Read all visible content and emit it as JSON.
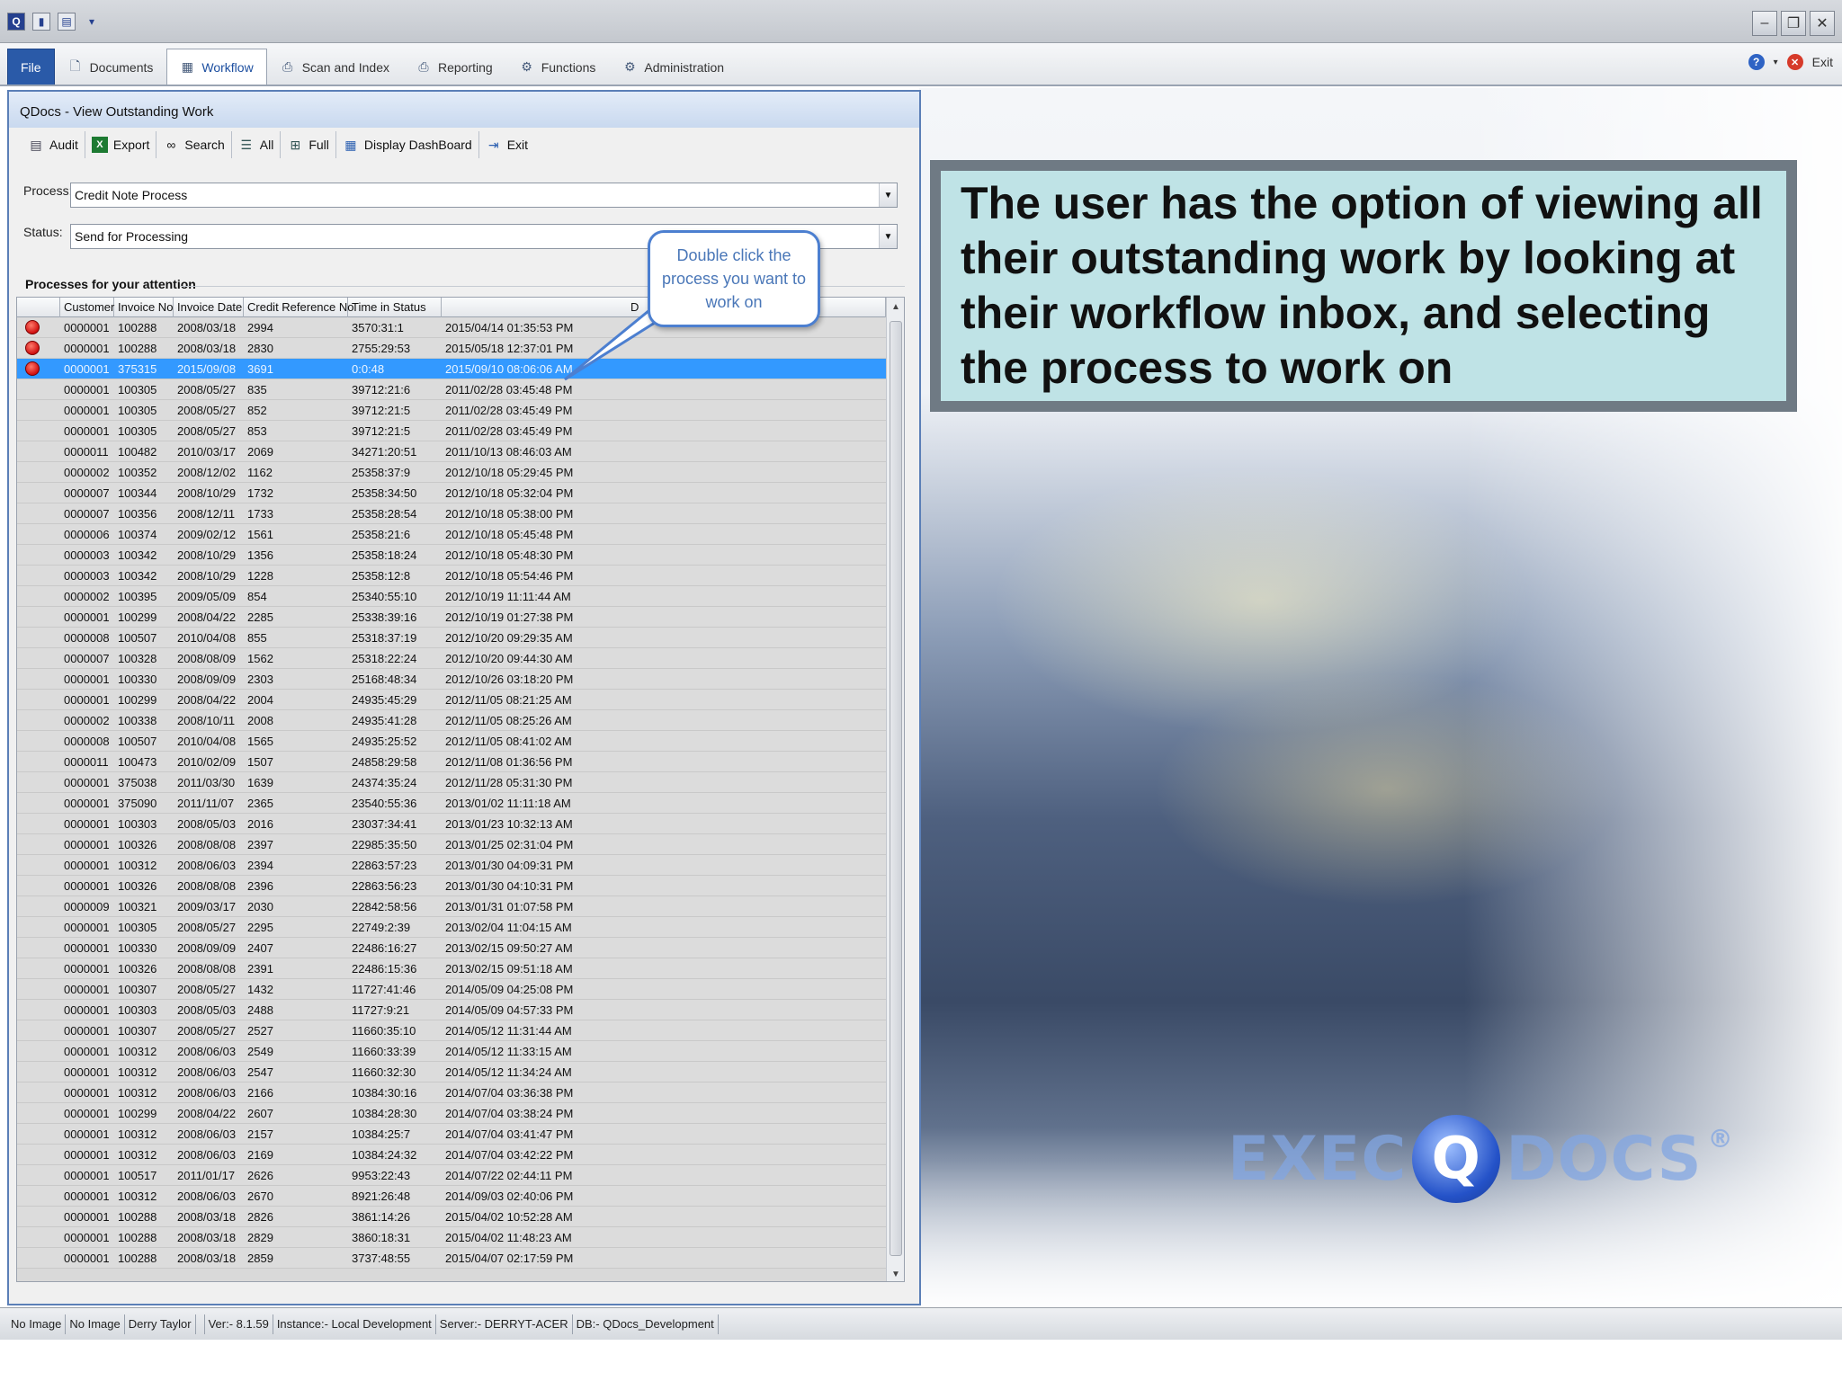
{
  "quick_access": {
    "icons": [
      "app-icon",
      "save-icon",
      "print-icon",
      "dropdown-icon"
    ]
  },
  "ribbon": {
    "tabs": [
      {
        "label": "File",
        "icon": ""
      },
      {
        "label": "Documents",
        "icon": "document-icon"
      },
      {
        "label": "Workflow",
        "icon": "workflow-icon"
      },
      {
        "label": "Scan and Index",
        "icon": "scanner-icon"
      },
      {
        "label": "Reporting",
        "icon": "printer-icon"
      },
      {
        "label": "Functions",
        "icon": "functions-icon"
      },
      {
        "label": "Administration",
        "icon": "gear-icon"
      }
    ],
    "exit_label": "Exit"
  },
  "window": {
    "title": "QDocs - View Outstanding Work"
  },
  "toolbar": {
    "buttons": [
      {
        "label": "Audit",
        "icon": "audit-icon",
        "glyph": "▤"
      },
      {
        "label": "Export",
        "icon": "excel-icon",
        "glyph": "X"
      },
      {
        "label": "Search",
        "icon": "binoculars-icon",
        "glyph": "⚲"
      },
      {
        "label": "All",
        "icon": "all-icon",
        "glyph": "☰"
      },
      {
        "label": "Full",
        "icon": "full-icon",
        "glyph": "⊞"
      },
      {
        "label": "Display DashBoard",
        "icon": "dashboard-icon",
        "glyph": "▦"
      },
      {
        "label": "Exit",
        "icon": "exit-door-icon",
        "glyph": "⇥"
      }
    ]
  },
  "filters": {
    "process_label": "Process:",
    "process_value": "Credit Note Process",
    "status_label": "Status:",
    "status_value": "Send for Processing"
  },
  "grid": {
    "section_label": "Processes for your attention",
    "columns": [
      "Customer",
      "Invoice No",
      "Invoice Date",
      "Credit Reference No",
      "Time in Status",
      "D"
    ],
    "rows": [
      {
        "flag": true,
        "cells": [
          "0000001",
          "100288",
          "2008/03/18",
          "2994",
          "3570:31:1",
          "2015/04/14 01:35:53 PM"
        ]
      },
      {
        "flag": true,
        "cells": [
          "0000001",
          "100288",
          "2008/03/18",
          "2830",
          "2755:29:53",
          "2015/05/18 12:37:01 PM"
        ]
      },
      {
        "flag": true,
        "selected": true,
        "cells": [
          "0000001",
          "375315",
          "2015/09/08",
          "3691",
          "0:0:48",
          "2015/09/10 08:06:06 AM"
        ]
      },
      {
        "cells": [
          "0000001",
          "100305",
          "2008/05/27",
          "835",
          "39712:21:6",
          "2011/02/28 03:45:48 PM"
        ]
      },
      {
        "cells": [
          "0000001",
          "100305",
          "2008/05/27",
          "852",
          "39712:21:5",
          "2011/02/28 03:45:49 PM"
        ]
      },
      {
        "cells": [
          "0000001",
          "100305",
          "2008/05/27",
          "853",
          "39712:21:5",
          "2011/02/28 03:45:49 PM"
        ]
      },
      {
        "cells": [
          "0000011",
          "100482",
          "2010/03/17",
          "2069",
          "34271:20:51",
          "2011/10/13 08:46:03 AM"
        ]
      },
      {
        "cells": [
          "0000002",
          "100352",
          "2008/12/02",
          "1162",
          "25358:37:9",
          "2012/10/18 05:29:45 PM"
        ]
      },
      {
        "cells": [
          "0000007",
          "100344",
          "2008/10/29",
          "1732",
          "25358:34:50",
          "2012/10/18 05:32:04 PM"
        ]
      },
      {
        "cells": [
          "0000007",
          "100356",
          "2008/12/11",
          "1733",
          "25358:28:54",
          "2012/10/18 05:38:00 PM"
        ]
      },
      {
        "cells": [
          "0000006",
          "100374",
          "2009/02/12",
          "1561",
          "25358:21:6",
          "2012/10/18 05:45:48 PM"
        ]
      },
      {
        "cells": [
          "0000003",
          "100342",
          "2008/10/29",
          "1356",
          "25358:18:24",
          "2012/10/18 05:48:30 PM"
        ]
      },
      {
        "cells": [
          "0000003",
          "100342",
          "2008/10/29",
          "1228",
          "25358:12:8",
          "2012/10/18 05:54:46 PM"
        ]
      },
      {
        "cells": [
          "0000002",
          "100395",
          "2009/05/09",
          "854",
          "25340:55:10",
          "2012/10/19 11:11:44 AM"
        ]
      },
      {
        "cells": [
          "0000001",
          "100299",
          "2008/04/22",
          "2285",
          "25338:39:16",
          "2012/10/19 01:27:38 PM"
        ]
      },
      {
        "cells": [
          "0000008",
          "100507",
          "2010/04/08",
          "855",
          "25318:37:19",
          "2012/10/20 09:29:35 AM"
        ]
      },
      {
        "cells": [
          "0000007",
          "100328",
          "2008/08/09",
          "1562",
          "25318:22:24",
          "2012/10/20 09:44:30 AM"
        ]
      },
      {
        "cells": [
          "0000001",
          "100330",
          "2008/09/09",
          "2303",
          "25168:48:34",
          "2012/10/26 03:18:20 PM"
        ]
      },
      {
        "cells": [
          "0000001",
          "100299",
          "2008/04/22",
          "2004",
          "24935:45:29",
          "2012/11/05 08:21:25 AM"
        ]
      },
      {
        "cells": [
          "0000002",
          "100338",
          "2008/10/11",
          "2008",
          "24935:41:28",
          "2012/11/05 08:25:26 AM"
        ]
      },
      {
        "cells": [
          "0000008",
          "100507",
          "2010/04/08",
          "1565",
          "24935:25:52",
          "2012/11/05 08:41:02 AM"
        ]
      },
      {
        "cells": [
          "0000011",
          "100473",
          "2010/02/09",
          "1507",
          "24858:29:58",
          "2012/11/08 01:36:56 PM"
        ]
      },
      {
        "cells": [
          "0000001",
          "375038",
          "2011/03/30",
          "1639",
          "24374:35:24",
          "2012/11/28 05:31:30 PM"
        ]
      },
      {
        "cells": [
          "0000001",
          "375090",
          "2011/11/07",
          "2365",
          "23540:55:36",
          "2013/01/02 11:11:18 AM"
        ]
      },
      {
        "cells": [
          "0000001",
          "100303",
          "2008/05/03",
          "2016",
          "23037:34:41",
          "2013/01/23 10:32:13 AM"
        ]
      },
      {
        "cells": [
          "0000001",
          "100326",
          "2008/08/08",
          "2397",
          "22985:35:50",
          "2013/01/25 02:31:04 PM"
        ]
      },
      {
        "cells": [
          "0000001",
          "100312",
          "2008/06/03",
          "2394",
          "22863:57:23",
          "2013/01/30 04:09:31 PM"
        ]
      },
      {
        "cells": [
          "0000001",
          "100326",
          "2008/08/08",
          "2396",
          "22863:56:23",
          "2013/01/30 04:10:31 PM"
        ]
      },
      {
        "cells": [
          "0000009",
          "100321",
          "2009/03/17",
          "2030",
          "22842:58:56",
          "2013/01/31 01:07:58 PM"
        ]
      },
      {
        "cells": [
          "0000001",
          "100305",
          "2008/05/27",
          "2295",
          "22749:2:39",
          "2013/02/04 11:04:15 AM"
        ]
      },
      {
        "cells": [
          "0000001",
          "100330",
          "2008/09/09",
          "2407",
          "22486:16:27",
          "2013/02/15 09:50:27 AM"
        ]
      },
      {
        "cells": [
          "0000001",
          "100326",
          "2008/08/08",
          "2391",
          "22486:15:36",
          "2013/02/15 09:51:18 AM"
        ]
      },
      {
        "cells": [
          "0000001",
          "100307",
          "2008/05/27",
          "1432",
          "11727:41:46",
          "2014/05/09 04:25:08 PM"
        ]
      },
      {
        "cells": [
          "0000001",
          "100303",
          "2008/05/03",
          "2488",
          "11727:9:21",
          "2014/05/09 04:57:33 PM"
        ]
      },
      {
        "cells": [
          "0000001",
          "100307",
          "2008/05/27",
          "2527",
          "11660:35:10",
          "2014/05/12 11:31:44 AM"
        ]
      },
      {
        "cells": [
          "0000001",
          "100312",
          "2008/06/03",
          "2549",
          "11660:33:39",
          "2014/05/12 11:33:15 AM"
        ]
      },
      {
        "cells": [
          "0000001",
          "100312",
          "2008/06/03",
          "2547",
          "11660:32:30",
          "2014/05/12 11:34:24 AM"
        ]
      },
      {
        "cells": [
          "0000001",
          "100312",
          "2008/06/03",
          "2166",
          "10384:30:16",
          "2014/07/04 03:36:38 PM"
        ]
      },
      {
        "cells": [
          "0000001",
          "100299",
          "2008/04/22",
          "2607",
          "10384:28:30",
          "2014/07/04 03:38:24 PM"
        ]
      },
      {
        "cells": [
          "0000001",
          "100312",
          "2008/06/03",
          "2157",
          "10384:25:7",
          "2014/07/04 03:41:47 PM"
        ]
      },
      {
        "cells": [
          "0000001",
          "100312",
          "2008/06/03",
          "2169",
          "10384:24:32",
          "2014/07/04 03:42:22 PM"
        ]
      },
      {
        "cells": [
          "0000001",
          "100517",
          "2011/01/17",
          "2626",
          "9953:22:43",
          "2014/07/22 02:44:11 PM"
        ]
      },
      {
        "cells": [
          "0000001",
          "100312",
          "2008/06/03",
          "2670",
          "8921:26:48",
          "2014/09/03 02:40:06 PM"
        ]
      },
      {
        "cells": [
          "0000001",
          "100288",
          "2008/03/18",
          "2826",
          "3861:14:26",
          "2015/04/02 10:52:28 AM"
        ]
      },
      {
        "cells": [
          "0000001",
          "100288",
          "2008/03/18",
          "2829",
          "3860:18:31",
          "2015/04/02 11:48:23 AM"
        ]
      },
      {
        "cells": [
          "0000001",
          "100288",
          "2008/03/18",
          "2859",
          "3737:48:55",
          "2015/04/07 02:17:59 PM"
        ]
      }
    ]
  },
  "bubble": {
    "text": "Double click the process you want to work on"
  },
  "callout": {
    "text": "The user has the option of viewing all their outstanding work by looking at their workflow inbox, and selecting the process to work on"
  },
  "logo": {
    "left": "EXEC",
    "q": "Q",
    "right": "DOCS",
    "mark": "®"
  },
  "statusbar": {
    "items": [
      "No Image",
      "No Image",
      "Derry Taylor",
      "",
      "Ver:- 8.1.59",
      "Instance:- Local Development",
      "Server:- DERRYT-ACER",
      "DB:- QDocs_Development"
    ]
  },
  "colors": {
    "selected_row": "#3399ff",
    "callout_bg": "#bfe3e6",
    "callout_border": "#6f7a84",
    "flag": "#d01010"
  }
}
